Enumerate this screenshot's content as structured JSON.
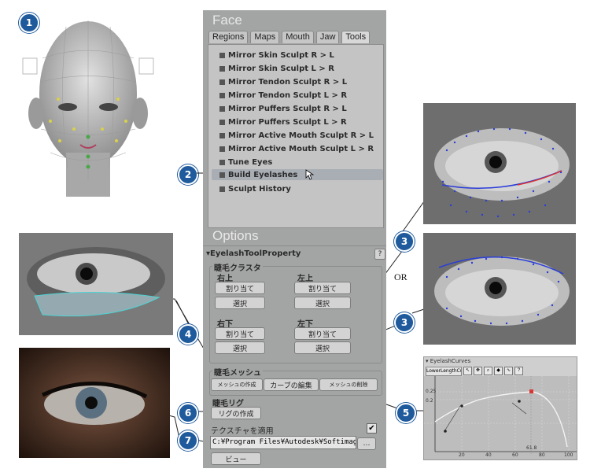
{
  "callouts": [
    "1",
    "2",
    "3",
    "3",
    "4",
    "5",
    "6",
    "7"
  ],
  "or_label": "OR",
  "panel": {
    "face_header": "Face",
    "tabs": [
      "Regions",
      "Maps",
      "Mouth",
      "Jaw",
      "Tools"
    ],
    "tools": [
      "Mirror Skin Sculpt R > L",
      "Mirror Skin Sculpt L > R",
      "Mirror Tendon Sculpt R > L",
      "Mirror Tendon Sculpt L > R",
      "Mirror Puffers Sculpt R > L",
      "Mirror Puffers Sculpt L > R",
      "Mirror Active Mouth Sculpt R > L",
      "Mirror Active Mouth Sculpt L > R",
      "Tune Eyes",
      "Build Eyelashes",
      "Sculpt History"
    ],
    "options_header": "Options",
    "property_title": "▾EyelashToolProperty",
    "help": "?",
    "cluster_label": "睫毛クラスタ",
    "upper_right": "右上",
    "upper_left": "左上",
    "lower_right": "右下",
    "lower_left": "左下",
    "assign": "割り当て",
    "select": "選択",
    "mesh_label": "睫毛メッシュ",
    "create_mesh": "メッシュの作成",
    "edit_curve": "カーブの編集",
    "delete_mesh": "メッシュの削除",
    "rig_label": "睫毛リグ",
    "create_rig": "リグの作成",
    "apply_texture": "テクスチャを適用",
    "texture_path": "C:¥Program Files¥Autodesk¥Softimage 2",
    "browse": "…",
    "view": "ビュー"
  },
  "curve_editor": {
    "title": "▾ EyelashCurves",
    "dropdown": "LowerLengthCurve",
    "toolbar_icons": [
      "pointer-icon",
      "pan-icon",
      "zoom-icon",
      "key-icon",
      "tangent-icon",
      "help-icon"
    ],
    "help": "?",
    "x_ticks": [
      "20",
      "40",
      "60",
      "80",
      "100"
    ],
    "y_ticks": [
      "0.25",
      "0.2"
    ],
    "marker": "61.8"
  }
}
